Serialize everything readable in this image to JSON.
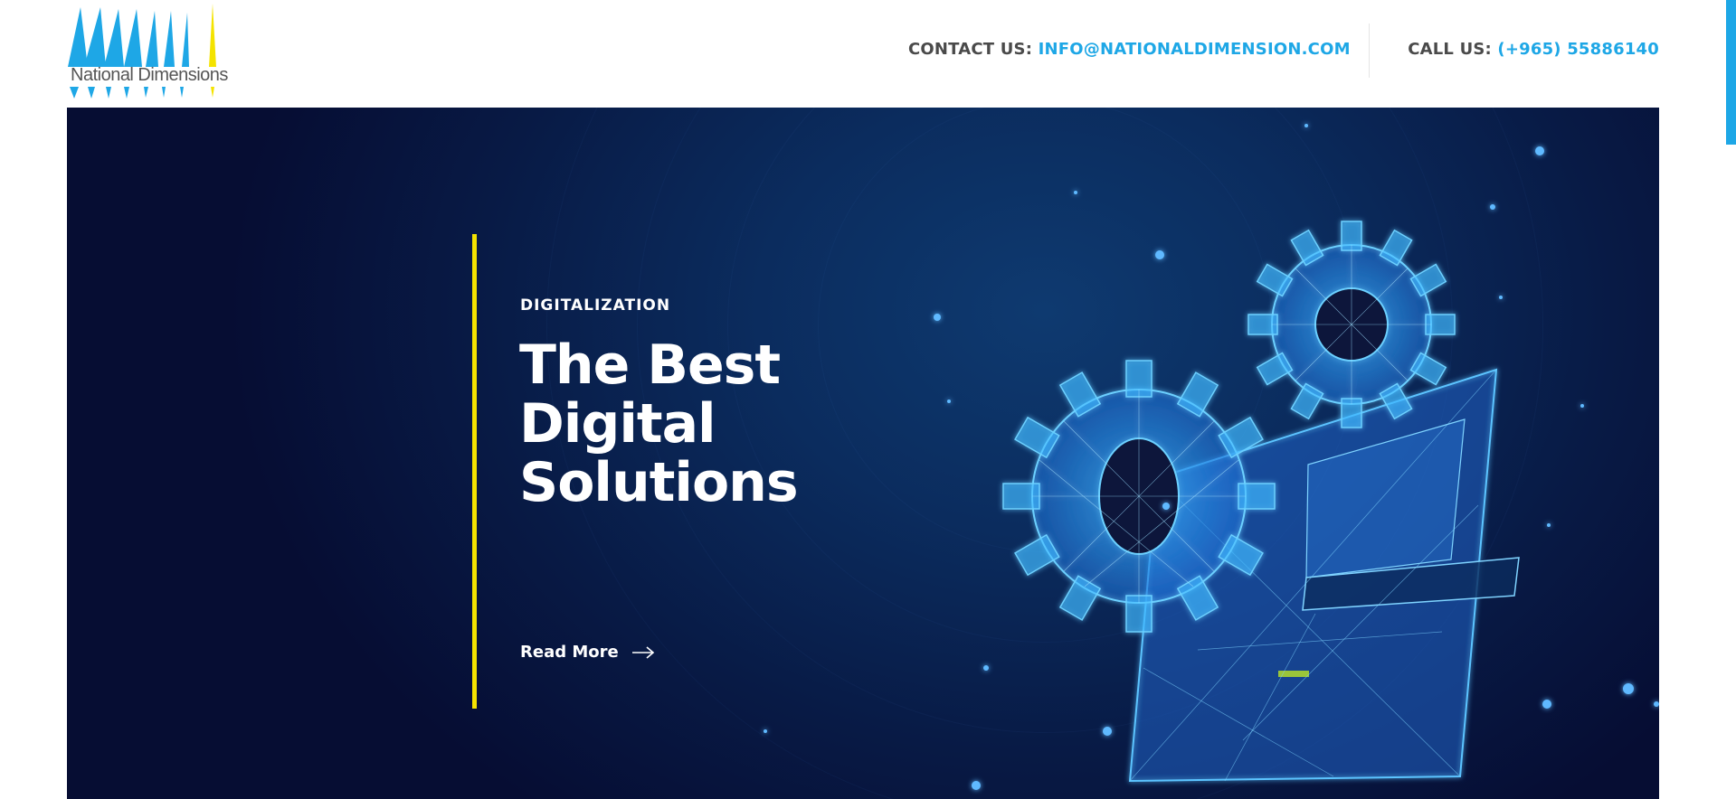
{
  "header": {
    "logo_text": "National Dimensions",
    "contact_label": "CONTACT US:",
    "contact_email": "INFO@NATIONALDIMENSION.COM",
    "call_label": "CALL US:",
    "call_phone": "(+965) 55886140"
  },
  "hero": {
    "eyebrow": "DIGITALIZATION",
    "headline": "The Best Digital Solutions",
    "read_more": "Read More",
    "icon": "arrow-right-icon"
  },
  "colors": {
    "accent_blue": "#1ea7e6",
    "accent_yellow": "#f4e300",
    "hero_dark": "#060d33"
  }
}
